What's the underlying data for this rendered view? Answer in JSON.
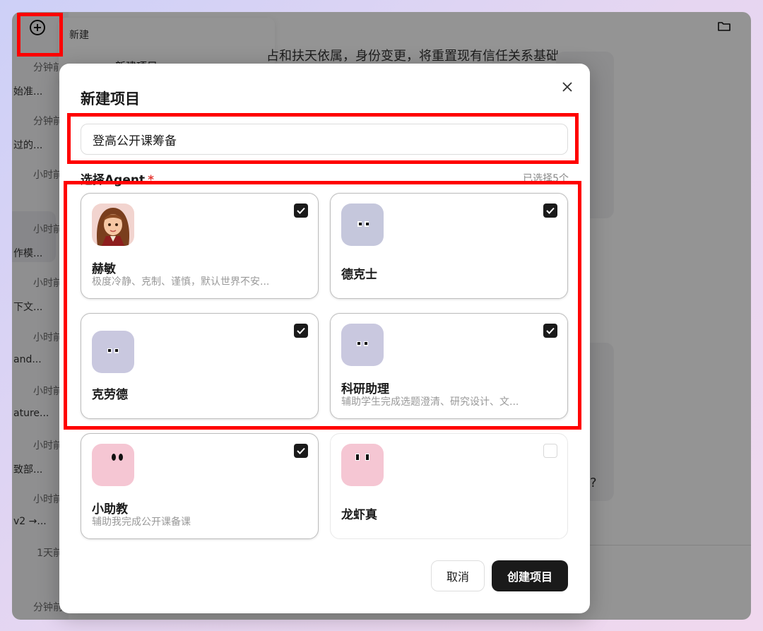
{
  "app": {
    "menu": {
      "new_label": "新建",
      "new_project_label": "新建项目"
    },
    "chat_snippet": "占和扶天依属，身份变更，将重置现有信任关系基础。",
    "question_mark": "?",
    "sidebar": [
      {
        "time": "分钟前",
        "preview": "始准..."
      },
      {
        "time": "分钟前",
        "preview": "过的..."
      },
      {
        "time": "小时前",
        "preview": ""
      },
      {
        "time": "小时前",
        "preview": "作模..."
      },
      {
        "time": "小时前",
        "preview": "下文..."
      },
      {
        "time": "小时前",
        "preview": "and..."
      },
      {
        "time": "小时前",
        "preview": "ature..."
      },
      {
        "time": "小时前",
        "preview": "致部..."
      },
      {
        "time": "小时前",
        "preview": "v2 →..."
      },
      {
        "time": "1天前",
        "preview": ""
      },
      {
        "time": "分钟前",
        "preview": ""
      }
    ]
  },
  "dialog": {
    "title": "新建项目",
    "project_name_value": "登高公开课筹备",
    "agent_label": "选择Agent",
    "required_mark": "*",
    "selected_count": "已选择5个",
    "agents": [
      {
        "name": "赫敏",
        "desc": "极度冷静、克制、谨慎，默认世界不安...",
        "checked": true,
        "avatar": "girl-portrait-avatar"
      },
      {
        "name": "德克士",
        "desc": "",
        "checked": true,
        "avatar": "robot-face-avatar"
      },
      {
        "name": "克劳德",
        "desc": "",
        "checked": true,
        "avatar": "robot-face-avatar"
      },
      {
        "name": "科研助理",
        "desc": "辅助学生完成选题澄清、研究设计、文...",
        "checked": true,
        "avatar": "robot-face-avatar"
      },
      {
        "name": "小助教",
        "desc": "辅助我完成公开课备课",
        "checked": true,
        "avatar": "pink-face-avatar"
      },
      {
        "name": "龙虾真",
        "desc": "",
        "checked": false,
        "avatar": "pink-face-avatar"
      }
    ],
    "cancel_label": "取消",
    "create_label": "创建项目"
  },
  "colors": {
    "primary_button": "#1a1a1a",
    "annotation_red": "#ff0000",
    "required_red": "#e53935",
    "avatar_gray": "#c5c7dc",
    "avatar_pink": "#f5c6d3"
  }
}
